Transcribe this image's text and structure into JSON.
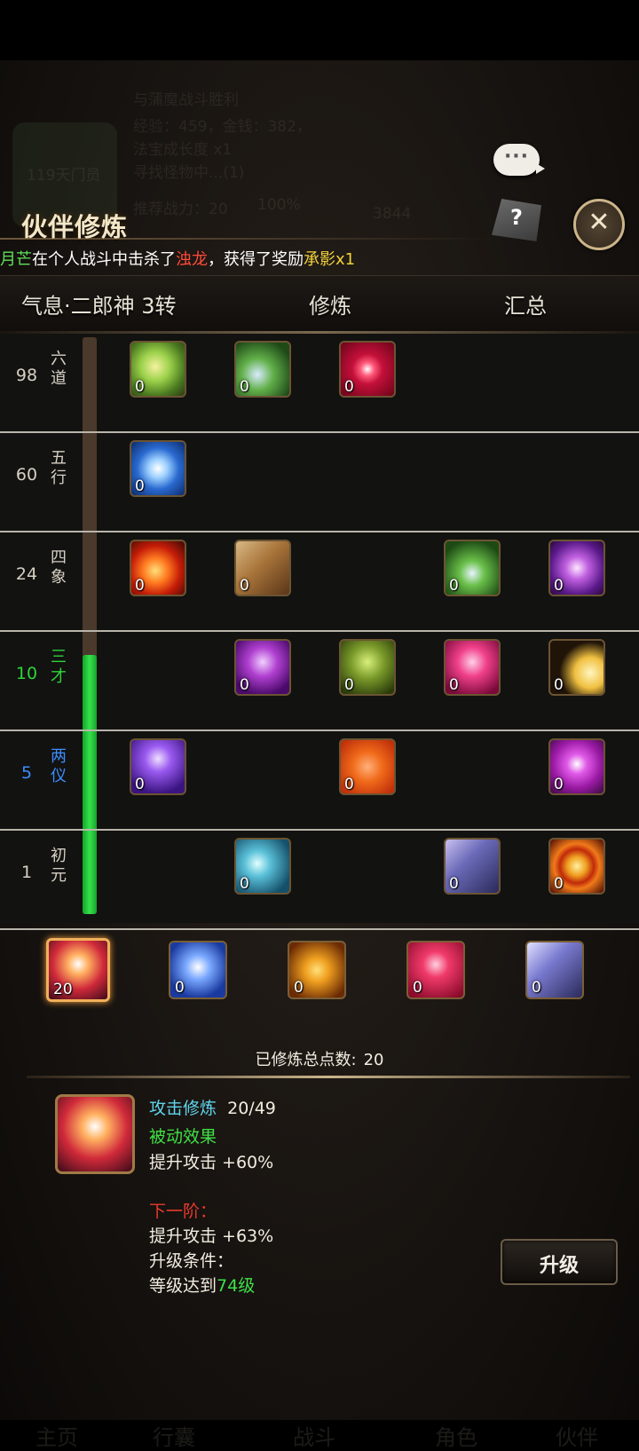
{
  "accent": "#f1b05a",
  "panel": {
    "title": "伙伴修炼"
  },
  "chat_bubble": {
    "icon": "chat-bubble-icon",
    "label": "···"
  },
  "help": {
    "label": "?"
  },
  "close": {
    "label": "✕"
  },
  "ticker": {
    "p1": "月芒",
    "p2": "在个人战斗中击杀了",
    "p3": "浊龙",
    "p4": "，获得了奖励",
    "p5": "承影",
    "p6": "x1"
  },
  "tabs": [
    {
      "label": "气息·二郎神 3转"
    },
    {
      "label": "修炼"
    },
    {
      "label": "汇总"
    }
  ],
  "progress": {
    "fraction": 0.45
  },
  "tiers": [
    {
      "level": "98",
      "name": "六\n道",
      "icons": [
        {
          "name": "tier98-swirl",
          "count": "0"
        },
        {
          "name": "tier98-leaf",
          "count": "0"
        },
        {
          "name": "tier98-eye",
          "count": "0"
        }
      ]
    },
    {
      "level": "60",
      "name": "五\n行",
      "icons": [
        {
          "name": "tier60-vortex",
          "count": "0"
        }
      ]
    },
    {
      "level": "24",
      "name": "四\n象",
      "icons": [
        {
          "name": "tier24-flame",
          "count": "0"
        },
        {
          "name": "tier24-book",
          "count": "0"
        },
        {
          "name": "tier24-feather",
          "count": "0"
        },
        {
          "name": "tier24-star",
          "count": "0"
        }
      ]
    },
    {
      "level": "10",
      "name": "三\n才",
      "icons": [
        {
          "name": "tier10-skull",
          "count": "0"
        },
        {
          "name": "tier10-beast",
          "count": "0"
        },
        {
          "name": "tier10-demon",
          "count": "0"
        },
        {
          "name": "tier10-shadow",
          "count": "0"
        }
      ]
    },
    {
      "level": "5",
      "name": "两\n仪",
      "icons": [
        {
          "name": "tier5-wings",
          "count": "0"
        },
        {
          "name": "tier5-rune",
          "count": "0"
        },
        {
          "name": "tier5-drop",
          "count": "0"
        }
      ]
    },
    {
      "level": "1",
      "name": "初\n元",
      "icons": [
        {
          "name": "tier1-fist",
          "count": "0"
        },
        {
          "name": "tier1-wind",
          "count": "0"
        },
        {
          "name": "tier1-target",
          "count": "0"
        }
      ]
    }
  ],
  "skills": [
    {
      "name": "attack-training",
      "count": "20"
    },
    {
      "name": "defense-training",
      "count": "0"
    },
    {
      "name": "body-training",
      "count": "0"
    },
    {
      "name": "crit-training",
      "count": "0"
    },
    {
      "name": "wind-training",
      "count": "0"
    }
  ],
  "total": {
    "label": "已修炼总点数:",
    "value": "20"
  },
  "detail": {
    "name": "攻击修炼",
    "progress": "20/49",
    "passive_label": "被动效果",
    "current_effect": "提升攻击 +60%",
    "next_label": "下一阶：",
    "next_effect": "提升攻击 +63%",
    "cond_label": "升级条件：",
    "cond_prefix": "等级达到",
    "cond_level": "74级"
  },
  "upgrade": {
    "label": "升级"
  },
  "background_ghost": {
    "name_line": "与蒲魔战斗胜利",
    "exp_line": "经验：459，金钱：382，",
    "growth_line": "法宝成长度 x1",
    "search_line": "寻找怪物中...(1)",
    "role_line": "119天门员",
    "reward_line": "推荐战力：20",
    "pct": "100%",
    "coins": "3844",
    "nav": [
      "主页",
      "行囊",
      "战斗",
      "角色",
      "伙伴"
    ]
  }
}
